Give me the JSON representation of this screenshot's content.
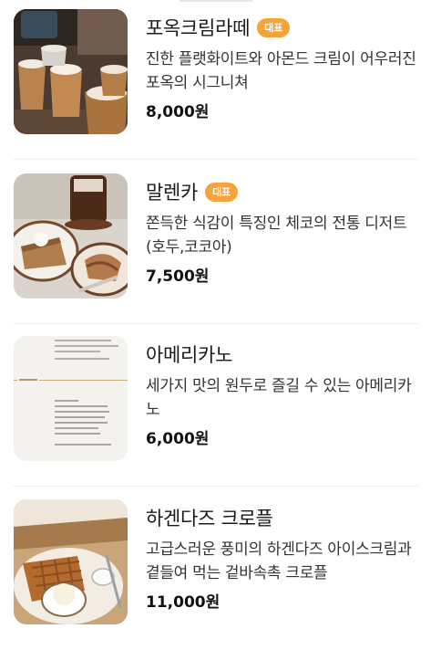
{
  "menu": {
    "items": [
      {
        "name": "포옥크림라떼",
        "badge": "대표",
        "description": "진한 플랫화이트와 아몬드 크림이 어우러진 포옥의 시그니쳐",
        "price": "8,000원",
        "image_icon": "cream-latte-photo"
      },
      {
        "name": "말렌카",
        "badge": "대표",
        "description": "쫀득한 식감이 특징인 체코의 전통 디저트 (호두,코코아)",
        "price": "7,500원",
        "image_icon": "medovnik-cake-photo"
      },
      {
        "name": "아메리카노",
        "badge": "",
        "description": "세가지 맛의 원두로 즐길 수 있는 아메리카노",
        "price": "6,000원",
        "image_icon": "bean-menu-card-photo"
      },
      {
        "name": "하겐다즈 크로플",
        "badge": "",
        "description": "고급스러운 풍미의 하겐다즈 아이스크림과 곁들여 먹는 겉바속촉 크로플",
        "price": "11,000원",
        "image_icon": "croffle-photo"
      }
    ]
  },
  "colors": {
    "badge": "#f6a33a",
    "divider": "#efefef",
    "text": "#1a1a1a"
  }
}
